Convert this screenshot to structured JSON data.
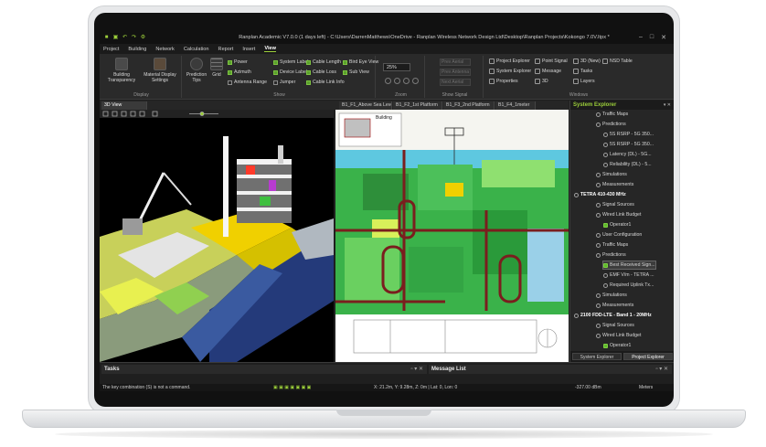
{
  "app": {
    "title": "Ranplan Academic V7.0.0 (1 days left) - C:\\Users\\DarrenMatthews\\OneDrive - Ranplan Wireless Network Design Ltd\\Desktop\\Ranplan Projects\\Kokongo 7.0V.Itpx *"
  },
  "menu_tabs": [
    "Project",
    "Building",
    "Network",
    "Calculation",
    "Report",
    "Insert",
    "View"
  ],
  "active_menu_tab": "View",
  "ribbon": {
    "display": {
      "label": "Display",
      "building_transparency": "Building Transparency",
      "material_display_settings": "Material Display Settings"
    },
    "show": {
      "label": "Show",
      "prediction_tips": "Prediction Tips",
      "grid": "Grid",
      "checks": [
        {
          "label": "Power",
          "checked": true
        },
        {
          "label": "Azimuth",
          "checked": true
        },
        {
          "label": "Antenna Range",
          "checked": false
        },
        {
          "label": "System Label",
          "checked": true
        },
        {
          "label": "Device Label",
          "checked": true
        },
        {
          "label": "Jumper",
          "checked": false
        },
        {
          "label": "Cable Length",
          "checked": true
        },
        {
          "label": "Cable Loss",
          "checked": true
        },
        {
          "label": "Cable Link Info",
          "checked": true
        },
        {
          "label": "Bird Eye View",
          "checked": true
        },
        {
          "label": "Sub View",
          "checked": true
        }
      ]
    },
    "zoom": {
      "label": "Zoom",
      "value": "25%"
    },
    "show_signal": {
      "label": "Show Signal",
      "items": [
        "Prev Aerial",
        "Prev Antenna",
        "Next Aerial"
      ]
    },
    "windows": {
      "label": "Windows",
      "items": [
        "Project Explorer",
        "Point Signal",
        "3D (New)",
        "NSD Table",
        "System Explorer",
        "Message",
        "Tasks",
        "Properties",
        "3D",
        "Layers"
      ]
    }
  },
  "doc_tabs": [
    "3D View",
    "B1_F1_Above Sea Level",
    "B1_F2_1st Platform",
    "B1_F3_2nd Platform",
    "B1_F4_1meter"
  ],
  "active_doc_tab": "3D View",
  "floorplan": {
    "inset_label": "Building"
  },
  "explorer": {
    "title": "System Explorer",
    "tree": [
      {
        "label": "Traffic Maps",
        "level": 3,
        "icon": "circle"
      },
      {
        "label": "Predictions",
        "level": 3,
        "icon": "circle"
      },
      {
        "label": "5S RSRP - 5G 350...",
        "level": 4,
        "icon": "circle"
      },
      {
        "label": "5S RSRP - 5G 350...",
        "level": 4,
        "icon": "circle"
      },
      {
        "label": "Latency (DL) - 5G...",
        "level": 4,
        "icon": "circle"
      },
      {
        "label": "Reliability (DL) - 5...",
        "level": 4,
        "icon": "circle"
      },
      {
        "label": "Simulations",
        "level": 3,
        "icon": "circle"
      },
      {
        "label": "Measurements",
        "level": 3,
        "icon": "circle"
      },
      {
        "label": "TETRA 410-430 MHz",
        "level": 1,
        "icon": "bold"
      },
      {
        "label": "Signal Sources",
        "level": 3,
        "icon": "circle"
      },
      {
        "label": "Wired Link Budget",
        "level": 3,
        "icon": "circle"
      },
      {
        "label": "Operator1",
        "level": 4,
        "icon": "green"
      },
      {
        "label": "User Configuration",
        "level": 3,
        "icon": "circle"
      },
      {
        "label": "Traffic Maps",
        "level": 3,
        "icon": "circle"
      },
      {
        "label": "Predictions",
        "level": 3,
        "icon": "circle"
      },
      {
        "label": "Best Received Sign...",
        "level": 4,
        "icon": "selected"
      },
      {
        "label": "EMF V/m - TETRA ...",
        "level": 4,
        "icon": "circle"
      },
      {
        "label": "Required Uplink Tx...",
        "level": 4,
        "icon": "circle"
      },
      {
        "label": "Simulations",
        "level": 3,
        "icon": "circle"
      },
      {
        "label": "Measurements",
        "level": 3,
        "icon": "circle"
      },
      {
        "label": "2100 FDD-LTE - Band 1 - 20MHz",
        "level": 1,
        "icon": "bold"
      },
      {
        "label": "Signal Sources",
        "level": 3,
        "icon": "circle"
      },
      {
        "label": "Wired Link Budget",
        "level": 3,
        "icon": "circle"
      },
      {
        "label": "Operator1",
        "level": 4,
        "icon": "green"
      }
    ],
    "tabs": [
      "System Explorer",
      "Project Explorer"
    ],
    "active_tab": "Project Explorer"
  },
  "tasks_panel": {
    "title": "Tasks"
  },
  "message_panel": {
    "title": "Message List"
  },
  "status": {
    "message": "The key combination (S) is not a command.",
    "coords": "X: 21.2m, Y: 9.28m, Z: 0m | Lat: 0, Lon: 0",
    "signal": "-327.00 dBm",
    "units": "Meters"
  }
}
